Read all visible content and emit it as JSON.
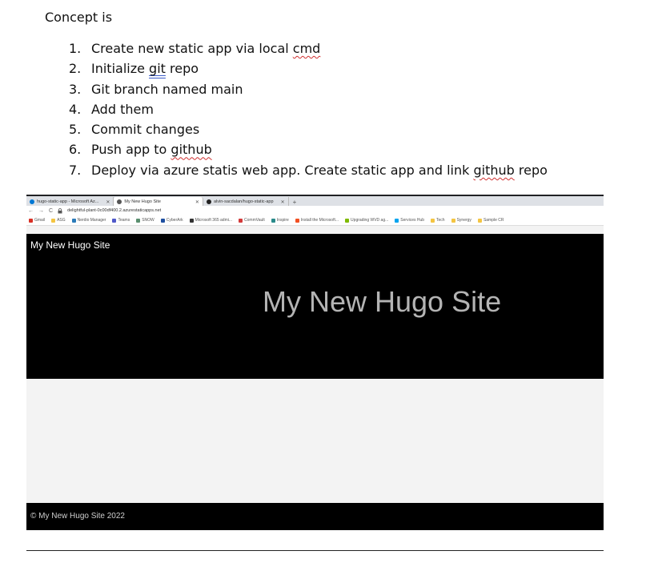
{
  "document": {
    "intro": "Concept is",
    "steps": [
      {
        "num": "1.",
        "pre": "Create new static app via local ",
        "mark": "cmd",
        "post": ""
      },
      {
        "num": "2.",
        "pre": "Initialize ",
        "mark": "git",
        "post": " repo"
      },
      {
        "num": "3.",
        "pre": "Git branch named main",
        "mark": "",
        "post": ""
      },
      {
        "num": "4.",
        "pre": "Add them",
        "mark": "",
        "post": ""
      },
      {
        "num": "5.",
        "pre": "Commit changes",
        "mark": "",
        "post": ""
      },
      {
        "num": "6.",
        "pre": "Push app to ",
        "mark": "github",
        "post": ""
      },
      {
        "num": "7.",
        "pre": "Deploy via azure statis web app. Create static app and link ",
        "mark": "github",
        "post": " repo"
      }
    ]
  },
  "browser": {
    "tabs": [
      {
        "label": "hugo-static-app - Microsoft Az...",
        "close": "✕",
        "icon": "azure-icon",
        "color": "#0078d4"
      },
      {
        "label": "My New Hugo Site",
        "close": "✕",
        "icon": "globe-icon",
        "color": "#555555"
      },
      {
        "label": "alvin-sacdalan/hugo-static-app",
        "close": "✕",
        "icon": "github-icon",
        "color": "#222222"
      }
    ],
    "new_tab": "+",
    "back": "←",
    "forward": "→",
    "reload": "C",
    "url": "delightful-plant-0c00df400.2.azurestaticapps.net",
    "bookmarks": [
      {
        "label": "Gmail",
        "color": "#d93025"
      },
      {
        "label": "ASG",
        "color": "#f4c542"
      },
      {
        "label": "Nerdio Manager",
        "color": "#2b7bb9"
      },
      {
        "label": "Teams",
        "color": "#5059c9"
      },
      {
        "label": "SNOW",
        "color": "#5a8f6f"
      },
      {
        "label": "CyberArk",
        "color": "#1e4fa0"
      },
      {
        "label": "Microsoft 365 admi...",
        "color": "#333333"
      },
      {
        "label": "CommVault",
        "color": "#d33a3a"
      },
      {
        "label": "Inspire",
        "color": "#2a8a8a"
      },
      {
        "label": "Install the Microsoft...",
        "color": "#f25022"
      },
      {
        "label": "Upgrading WVD ag...",
        "color": "#7fba00"
      },
      {
        "label": "Services Hub",
        "color": "#00a4ef"
      },
      {
        "label": "Tech",
        "color": "#f4c542"
      },
      {
        "label": "Synergy",
        "color": "#f4c542"
      },
      {
        "label": "Sample CR",
        "color": "#f4c542"
      }
    ]
  },
  "site": {
    "brand": "My New Hugo Site",
    "hero_title": "My New Hugo Site",
    "footer": "© My New Hugo Site 2022"
  }
}
